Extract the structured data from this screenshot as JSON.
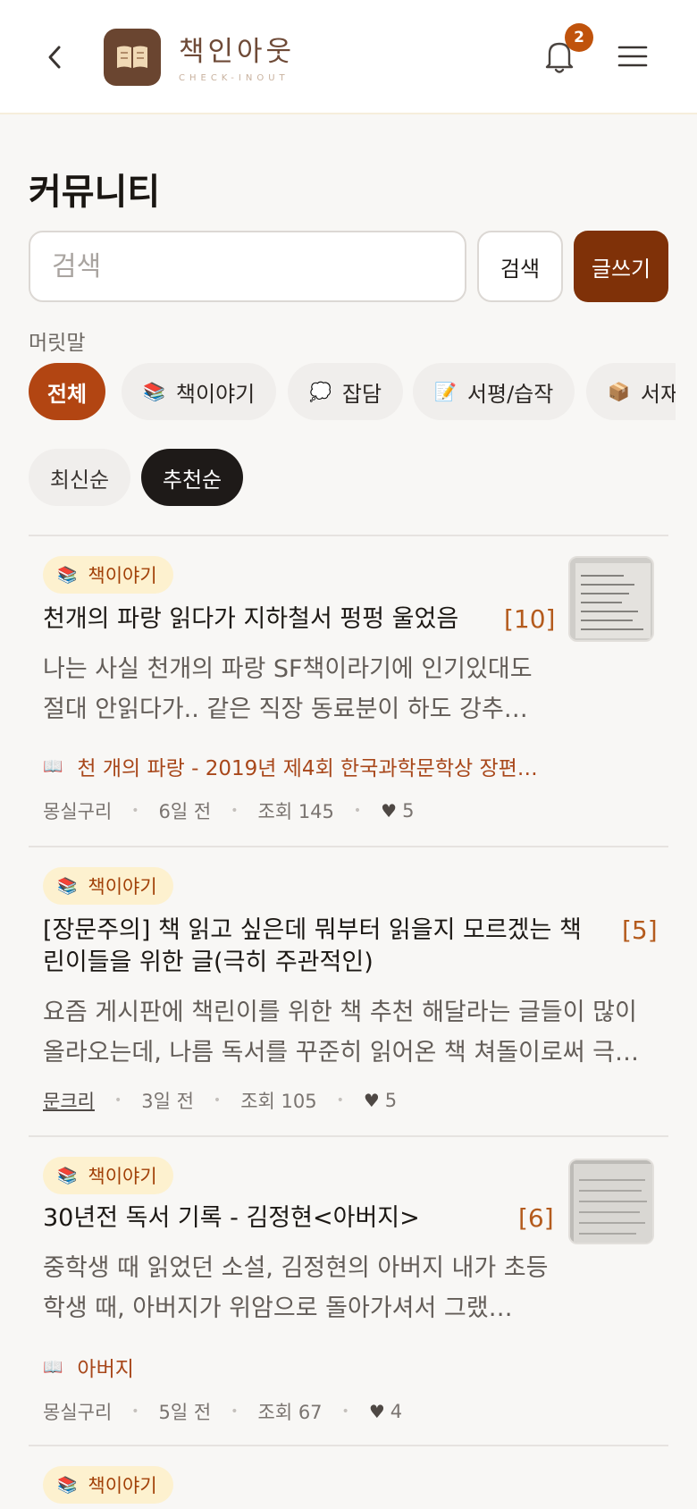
{
  "header": {
    "brand_name": "책인아웃",
    "brand_sub": "CHECK-INOUT",
    "notification_count": "2"
  },
  "page": {
    "title": "커뮤니티"
  },
  "search": {
    "placeholder": "검색",
    "button_label": "검색",
    "write_label": "글쓰기"
  },
  "filter": {
    "label": "머릿말",
    "chips": [
      {
        "label": "전체",
        "icon": "",
        "active": true
      },
      {
        "label": "책이야기",
        "icon": "📚",
        "active": false
      },
      {
        "label": "잡담",
        "icon": "💭",
        "active": false
      },
      {
        "label": "서평/습작",
        "icon": "📝",
        "active": false
      },
      {
        "label": "서재",
        "icon": "📦",
        "active": false
      }
    ]
  },
  "sort": {
    "latest": "최신순",
    "recommended": "추천순",
    "selected": "추천순"
  },
  "posts": [
    {
      "tag": "책이야기",
      "tag_icon": "📚",
      "title": "천개의 파랑 읽다가 지하철서 펑펑 울었음",
      "comments": "[10]",
      "excerpt": "나는 사실 천개의 파랑 SF책이라기에 인기있대도 절대 안읽다가.. 같은 직장 동료분이 하도 강추…",
      "book_icon": "📖",
      "book": "천 개의 파랑 - 2019년 제4회 한국과학문학상 장편…",
      "author": "몽실구리",
      "date": "6일 전",
      "views": "조회 145",
      "likes": "5",
      "has_thumb": true
    },
    {
      "tag": "책이야기",
      "tag_icon": "📚",
      "title_line1": "[장문주의] 책 읽고 싶은데 뭐부터 읽을지 모르겠는 책",
      "title_line2": "린이들을 위한 글(극히 주관적인)",
      "comments": "[5]",
      "excerpt": "요즘 게시판에 책린이를 위한 책 추천 해달라는 글들이 많이 올라오는데, 나름 독서를 꾸준히 읽어온 책 쳐돌이로써 극…",
      "author": "문크리",
      "date": "3일 전",
      "views": "조회 105",
      "likes": "5",
      "has_thumb": false
    },
    {
      "tag": "책이야기",
      "tag_icon": "📚",
      "title": "30년전 독서 기록 - 김정현<아버지>",
      "comments": "[6]",
      "excerpt": "중학생 때 읽었던 소설, 김정현의 아버지 내가 초등학생 때, 아버지가 위암으로 돌아가셔서 그랬…",
      "book_icon": "📖",
      "book": "아버지",
      "author": "몽실구리",
      "date": "5일 전",
      "views": "조회 67",
      "likes": "4",
      "has_thumb": true
    },
    {
      "tag": "책이야기",
      "tag_icon": "📚"
    }
  ]
}
